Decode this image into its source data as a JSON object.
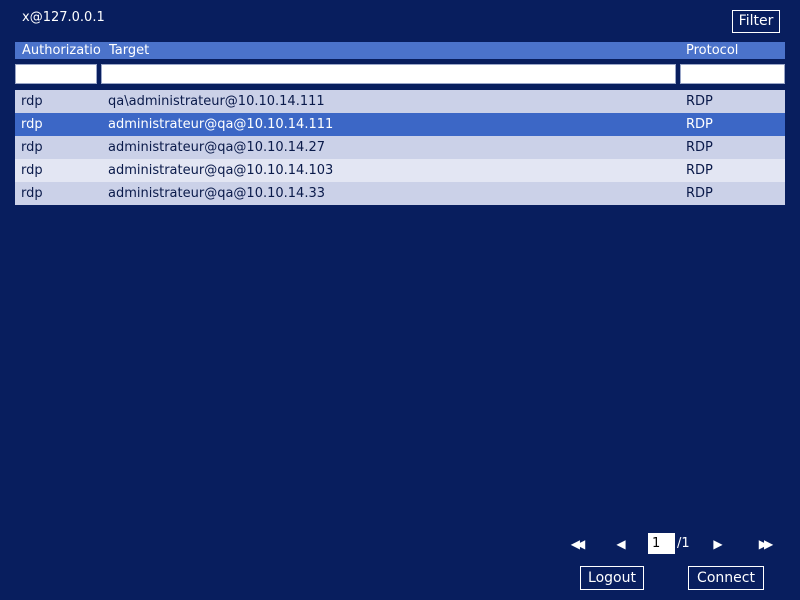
{
  "header": {
    "user": "x@127.0.0.1",
    "filter_label": "Filter"
  },
  "table": {
    "columns": [
      "Authorization",
      "Target",
      "Protocol"
    ],
    "filters": {
      "authorization": "",
      "target": "",
      "protocol": ""
    },
    "rows": [
      {
        "authorization": "rdp",
        "target": "qa\\administrateur@10.10.14.111",
        "protocol": "RDP",
        "selected": false
      },
      {
        "authorization": "rdp",
        "target": "administrateur@qa@10.10.14.111",
        "protocol": "RDP",
        "selected": true
      },
      {
        "authorization": "rdp",
        "target": "administrateur@qa@10.10.14.27",
        "protocol": "RDP",
        "selected": false
      },
      {
        "authorization": "rdp",
        "target": "administrateur@qa@10.10.14.103",
        "protocol": "RDP",
        "selected": false
      },
      {
        "authorization": "rdp",
        "target": "administrateur@qa@10.10.14.33",
        "protocol": "RDP",
        "selected": false
      }
    ]
  },
  "pager": {
    "first_icon": "first-page-icon",
    "prev_icon": "previous-page-icon",
    "next_icon": "next-page-icon",
    "last_icon": "last-page-icon",
    "current_page": "1",
    "total_pages": "/1"
  },
  "actions": {
    "logout_label": "Logout",
    "connect_label": "Connect"
  },
  "colors": {
    "background": "#081e5e",
    "header_background": "#4b73cb",
    "row_odd": "#cbd1e8",
    "row_even": "#e3e6f3",
    "row_selected": "#3c67c6"
  }
}
